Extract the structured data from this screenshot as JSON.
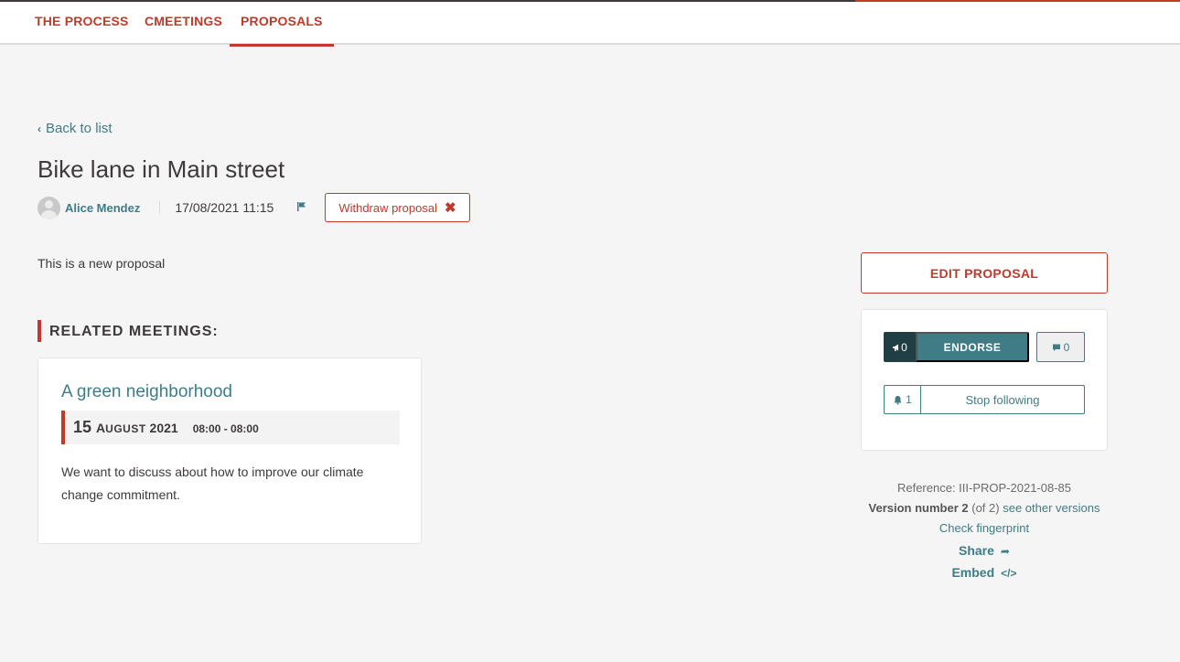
{
  "nav": {
    "tabs": [
      {
        "label": "THE PROCESS"
      },
      {
        "label": "CMEETINGS"
      },
      {
        "label": "PROPOSALS"
      }
    ]
  },
  "back_link": "Back to list",
  "proposal": {
    "title": "Bike lane in Main street",
    "author": "Alice Mendez",
    "date": "17/08/2021 11:15",
    "withdraw_label": "Withdraw proposal",
    "body": "This is a new proposal"
  },
  "related": {
    "heading": "RELATED MEETINGS:",
    "meeting": {
      "title": "A green neighborhood",
      "day": "15",
      "month_first": "A",
      "month_rest": "UGUST",
      "year": "2021",
      "time": "08:00 - 08:00",
      "description": "We want to discuss about how to improve our climate change commitment."
    }
  },
  "sidebar": {
    "edit_label": "EDIT PROPOSAL",
    "endorse_count": "0",
    "endorse_label": "ENDORSE",
    "comments_count": "0",
    "followers_count": "1",
    "follow_label": "Stop following",
    "reference": "Reference: III-PROP-2021-08-85",
    "version_label": "Version number 2",
    "version_of": "(of 2)",
    "see_versions": "see other versions",
    "fingerprint": "Check fingerprint",
    "share": "Share",
    "embed": "Embed"
  },
  "colors": {
    "accent": "#c0392b",
    "primary": "#3f7c85",
    "dark": "#1f3f44"
  }
}
